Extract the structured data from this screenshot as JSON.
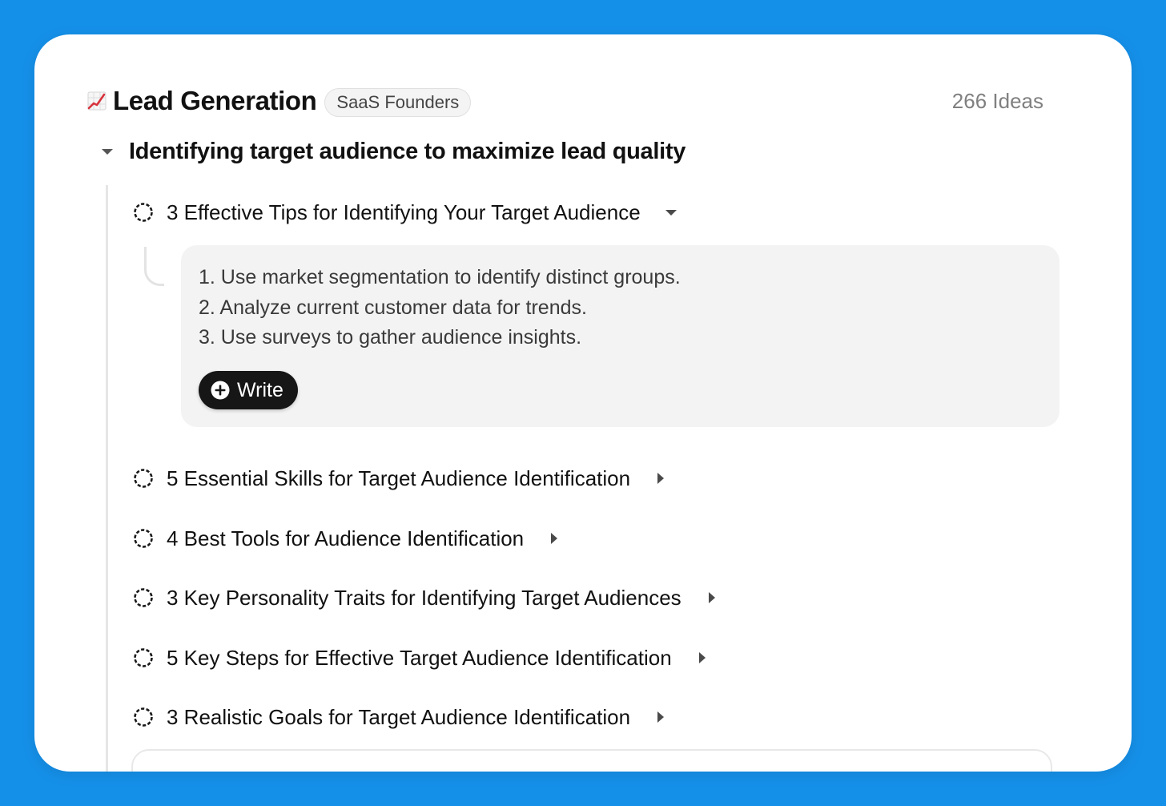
{
  "header": {
    "emoji": "📈",
    "emoji_icon": "chart-increasing-icon",
    "title": "Lead Generation",
    "tag": "SaaS Founders",
    "count": "266 Ideas"
  },
  "section": {
    "title": "Identifying target audience to maximize lead quality",
    "expanded": true
  },
  "ideas": [
    {
      "label": "3 Effective Tips for Identifying Your Target Audience",
      "expanded": true,
      "content": [
        "1. Use market segmentation to identify distinct groups.",
        "2. Analyze current customer data for trends.",
        "3. Use surveys to gather audience insights."
      ],
      "action_label": "Write"
    },
    {
      "label": "5 Essential Skills for Target Audience Identification",
      "expanded": false
    },
    {
      "label": "4 Best Tools for Audience Identification",
      "expanded": false
    },
    {
      "label": "3 Key Personality Traits for Identifying Target Audiences",
      "expanded": false
    },
    {
      "label": "5 Key Steps for Effective Target Audience Identification",
      "expanded": false
    },
    {
      "label": "3 Realistic Goals for Target Audience Identification",
      "expanded": false
    }
  ],
  "colors": {
    "background": "#1590e9",
    "card": "#ffffff",
    "panel": "#f3f3f3",
    "button": "#161616"
  }
}
